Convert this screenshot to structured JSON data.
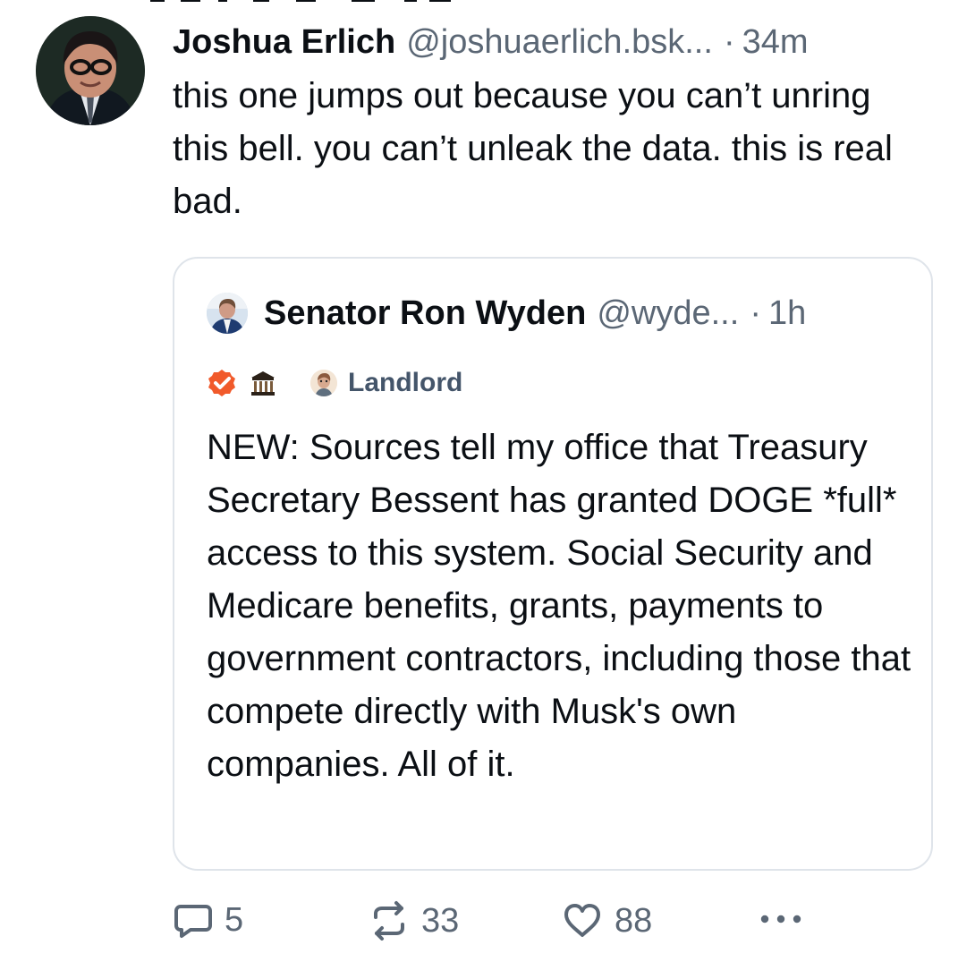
{
  "post": {
    "author_name": "Joshua Erlich",
    "author_handle": "@joshuaerlich.bsk...",
    "separator": "·",
    "time": "34m",
    "text": "this one jumps out because you can’t unring this bell. you can’t unleak the data. this is real bad."
  },
  "quote": {
    "author_name": "Senator Ron Wyden",
    "author_handle": "@wyde...",
    "separator": "·",
    "time": "1h",
    "badges": [
      "verified-checkmark-icon",
      "government-building-icon"
    ],
    "label": "Landlord",
    "text": "NEW: Sources tell my office that Treasury Secretary Bessent has granted DOGE *full* access to this system. Social Security and Medicare benefits, grants, payments to government contractors, including those that compete directly with Musk's own companies. All of it."
  },
  "actions": {
    "reply_count": "5",
    "repost_count": "33",
    "like_count": "88",
    "more_icon": "more-horizontal-icon"
  },
  "colors": {
    "text": "#0b0f14",
    "muted": "#5b6775",
    "border": "#dfe4ea",
    "verified": "#f15a2b",
    "label_text": "#44556a"
  }
}
